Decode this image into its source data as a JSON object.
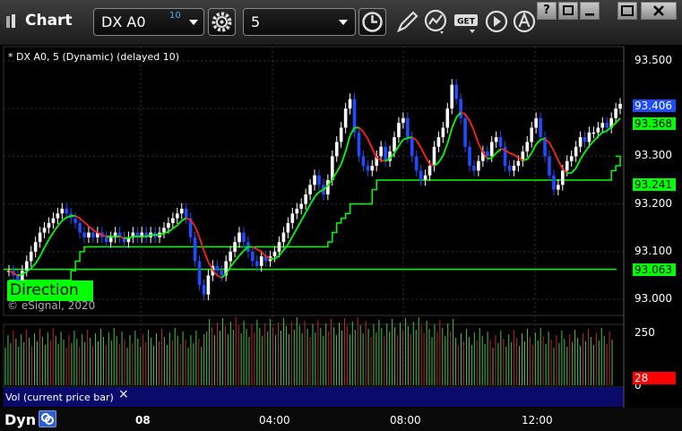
{
  "window": {
    "title": "Chart",
    "buttons": {
      "help": "?",
      "restore": "",
      "maximize": "",
      "close": ""
    }
  },
  "toolbar": {
    "symbol": "DX A0",
    "symbol_badge": "10",
    "interval": "5",
    "tools": [
      "settings-gear-icon",
      "clock-icon",
      "pencil-icon",
      "studies-icon",
      "get-icon",
      "play-icon",
      "alert-icon"
    ],
    "get_label": "GET"
  },
  "study_label": "* DX A0, 5 (Dynamic) (delayed 10)",
  "direction_label": "Direction",
  "copyright": "© eSignal, 2020",
  "volume_label": "Vol (current price bar)",
  "volume_close": "×",
  "bottom_label": "Dyn",
  "colors": {
    "up_candle": "#ffffff",
    "down_candle": "#1e4cff",
    "ma_up": "#00ff00",
    "ma_down": "#ff2020",
    "stop_line": "#00ff00",
    "vol_up": "#4cc04c",
    "vol_down": "#c02828",
    "volume_marker": "#ff0000",
    "current_price_tag": "#1e4cff"
  },
  "chart_data": {
    "type": "candlestick",
    "symbol": "DX A0",
    "interval": "5",
    "y_axis": {
      "ticks": [
        "93.500",
        "93.400",
        "93.300",
        "93.200",
        "93.100",
        "93.000"
      ],
      "min": 92.97,
      "max": 93.53
    },
    "x_axis": {
      "ticks": [
        "08",
        "04:00",
        "08:00",
        "12:00"
      ]
    },
    "price_tags": [
      {
        "value": "93.406",
        "color": "#1e4cff"
      },
      {
        "value": "93.368",
        "color": "#00ff00"
      },
      {
        "value": "93.241",
        "color": "#00ff00"
      },
      {
        "value": "93.063",
        "color": "#00ff00"
      }
    ],
    "volume_axis": {
      "ticks": [
        "250",
        "0"
      ],
      "marker": "28"
    },
    "close": [
      93.06,
      93.05,
      93.04,
      93.06,
      93.08,
      93.1,
      93.12,
      93.14,
      93.15,
      93.16,
      93.17,
      93.18,
      93.19,
      93.18,
      93.17,
      93.16,
      93.14,
      93.13,
      93.14,
      93.13,
      93.14,
      93.13,
      93.12,
      93.13,
      93.14,
      93.13,
      93.12,
      93.13,
      93.14,
      93.13,
      93.14,
      93.13,
      93.14,
      93.13,
      93.14,
      93.15,
      93.16,
      93.17,
      93.18,
      93.19,
      93.17,
      93.13,
      93.08,
      93.03,
      93.01,
      93.05,
      93.07,
      93.06,
      93.05,
      93.08,
      93.1,
      93.12,
      93.14,
      93.12,
      93.1,
      93.08,
      93.07,
      93.09,
      93.08,
      93.09,
      93.1,
      93.12,
      93.14,
      93.16,
      93.18,
      93.19,
      93.2,
      93.22,
      93.24,
      93.26,
      93.24,
      93.22,
      93.25,
      93.3,
      93.33,
      93.36,
      93.4,
      93.42,
      93.35,
      93.3,
      93.28,
      93.27,
      93.28,
      93.3,
      93.32,
      93.29,
      93.31,
      93.34,
      93.37,
      93.38,
      93.34,
      93.3,
      93.27,
      93.25,
      93.26,
      93.28,
      93.32,
      93.34,
      93.36,
      93.4,
      93.45,
      93.42,
      93.38,
      93.32,
      93.28,
      93.27,
      93.29,
      93.31,
      93.3,
      93.33,
      93.34,
      93.32,
      93.28,
      93.27,
      93.28,
      93.29,
      93.31,
      93.33,
      93.36,
      93.38,
      93.34,
      93.3,
      93.26,
      93.23,
      93.24,
      93.27,
      93.29,
      93.3,
      93.32,
      93.34,
      93.33,
      93.35,
      93.35,
      93.36,
      93.37,
      93.36,
      93.38,
      93.4,
      93.41
    ]
  }
}
